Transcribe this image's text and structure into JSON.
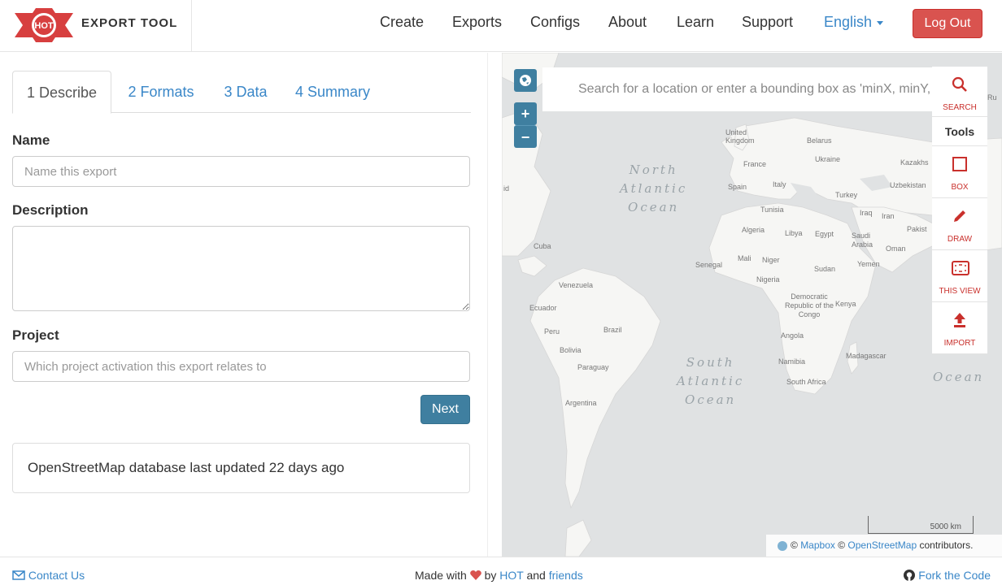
{
  "header": {
    "logo_text": "HOT",
    "app_name": "EXPORT TOOL",
    "nav": [
      "Create",
      "Exports",
      "Configs",
      "About",
      "Learn",
      "Support"
    ],
    "language": "English",
    "logout": "Log Out"
  },
  "tabs": [
    "1 Describe",
    "2 Formats",
    "3 Data",
    "4 Summary"
  ],
  "form": {
    "name_label": "Name",
    "name_placeholder": "Name this export",
    "description_label": "Description",
    "project_label": "Project",
    "project_placeholder": "Which project activation this export relates to",
    "next": "Next"
  },
  "status_message": "OpenStreetMap database last updated 22 days ago",
  "map": {
    "search_placeholder": "Search for a location or enter a bounding box as 'minX, minY, maxX, maxY'",
    "zoom_in": "+",
    "zoom_out": "−",
    "search_label": "SEARCH",
    "tools_header": "Tools",
    "tools": [
      {
        "label": "BOX",
        "icon": "box-icon"
      },
      {
        "label": "DRAW",
        "icon": "pencil-icon"
      },
      {
        "label": "THIS VIEW",
        "icon": "this-view-icon"
      },
      {
        "label": "IMPORT",
        "icon": "upload-icon"
      }
    ],
    "scale_label": "5000 km",
    "attribution": {
      "mapbox": "Mapbox",
      "osm": "OpenStreetMap",
      "suffix": "contributors."
    },
    "oceans": {
      "north_atlantic": [
        "North",
        "Atlantic",
        "Ocean"
      ],
      "south_atlantic": [
        "South",
        "Atlantic",
        "Ocean"
      ],
      "indian": "Ocean"
    },
    "places": {
      "uk": "United Kingdom",
      "belarus": "Belarus",
      "ukraine": "Ukraine",
      "france": "France",
      "kazakh": "Kazakhs",
      "spain": "Spain",
      "italy": "Italy",
      "uzbek": "Uzbekistan",
      "turkey": "Turkey",
      "tunisia": "Tunisia",
      "iraq": "Iraq",
      "iran": "Iran",
      "pakist": "Pakist",
      "algeria": "Algeria",
      "libya": "Libya",
      "egypt": "Egypt",
      "saudi": "Saudi Arabia",
      "oman": "Oman",
      "cuba": "Cuba",
      "mali": "Mali",
      "niger": "Niger",
      "senegal": "Senegal",
      "sudan": "Sudan",
      "yemen": "Yemen",
      "nigeria": "Nigeria",
      "venezuela": "Venezuela",
      "drc": "Democratic Republic of the Congo",
      "kenya": "Kenya",
      "ecuador": "Ecuador",
      "peru": "Peru",
      "brazil": "Brazil",
      "bolivia": "Bolivia",
      "angola": "Angola",
      "paraguay": "Paraguay",
      "namibia": "Namibia",
      "madagascar": "Madagascar",
      "south_africa": "South Africa",
      "argentina": "Argentina",
      "edge_left": "id",
      "edge_right": "Ru"
    }
  },
  "footer": {
    "contact": "Contact Us",
    "made_with": "Made with",
    "by": "by",
    "hot": "HOT",
    "and": "and",
    "friends": "friends",
    "fork": "Fork the Code"
  },
  "colors": {
    "accent": "#3a87c8",
    "primary": "#3f7fa0",
    "danger": "#d9534f"
  }
}
